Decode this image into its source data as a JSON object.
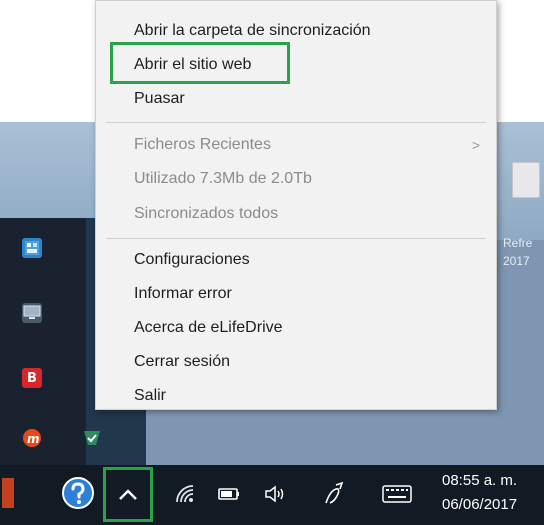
{
  "context_menu": {
    "items": [
      {
        "label": "Abrir la carpeta de sincronización",
        "enabled": true
      },
      {
        "label": "Abrir el sitio web",
        "enabled": true,
        "highlighted": true
      },
      {
        "label": "Puasar",
        "enabled": true
      },
      {
        "label": "Ficheros Recientes",
        "enabled": false,
        "has_submenu": true
      },
      {
        "label": "Utilizado 7.3Mb de 2.0Tb",
        "enabled": false
      },
      {
        "label": "Sincronizados todos",
        "enabled": false
      },
      {
        "label": "Configuraciones",
        "enabled": true
      },
      {
        "label": "Informar error",
        "enabled": true
      },
      {
        "label": "Acerca de eLifeDrive",
        "enabled": true
      },
      {
        "label": "Cerrar sesión",
        "enabled": true
      },
      {
        "label": "Salir",
        "enabled": true
      }
    ],
    "submenu_arrow": ">",
    "highlight_color": "#2aa24a"
  },
  "desktop": {
    "right_label_line1": "Refre",
    "right_label_line2": "2017"
  },
  "dock": {
    "b_app_letter": "B"
  },
  "taskbar": {
    "show_hidden_icons_highlighted": true,
    "clock_time": "08:55 a. m.",
    "clock_date": "06/06/2017"
  }
}
